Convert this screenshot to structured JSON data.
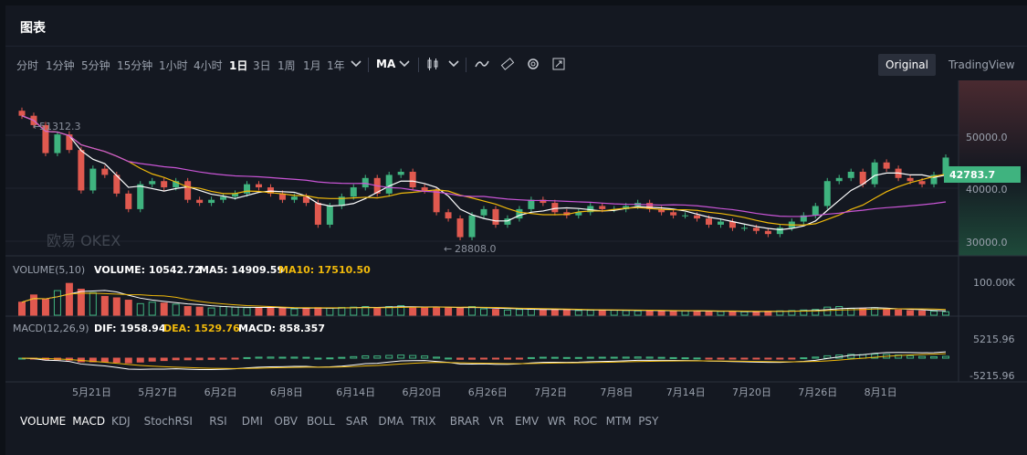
{
  "header": {
    "title": "图表"
  },
  "toolbar": {
    "intervals": [
      "分时",
      "1分钟",
      "5分钟",
      "15分钟",
      "1小时",
      "4小时",
      "1日",
      "3日",
      "1周",
      "1月",
      "1年"
    ],
    "active_interval": "1日",
    "ma_label": "MA",
    "modes": [
      "Original",
      "TradingView"
    ],
    "active_mode": "Original"
  },
  "price_chart": {
    "high_marker": "51312.3",
    "low_marker": "28808.0",
    "current_price": "42783.7",
    "y_ticks": [
      "50000.0",
      "40000.0",
      "30000.0"
    ],
    "watermark": "欧易 OKEX"
  },
  "volume": {
    "label": "VOLUME(5,10)",
    "volume_text": "VOLUME: 10542.72",
    "ma5_text": "MA5: 14909.59",
    "ma10_text": "MA10: 17510.50",
    "y_tick": "100.00K"
  },
  "macd": {
    "label": "MACD(12,26,9)",
    "dif_text": "DIF: 1958.94",
    "dea_text": "DEA: 1529.76",
    "macd_text": "MACD: 858.357",
    "y_ticks": [
      "5215.96",
      "-5215.96"
    ]
  },
  "x_ticks": [
    "5月21日",
    "5月27日",
    "6月2日",
    "6月8日",
    "6月14日",
    "6月20日",
    "6月26日",
    "7月2日",
    "7月8日",
    "7月14日",
    "7月20日",
    "7月26日",
    "8月1日"
  ],
  "indicators": [
    "VOLUME",
    "MACD",
    "KDJ",
    "StochRSI",
    "RSI",
    "DMI",
    "OBV",
    "BOLL",
    "SAR",
    "DMA",
    "TRIX",
    "BRAR",
    "VR",
    "EMV",
    "WR",
    "ROC",
    "MTM",
    "PSY"
  ],
  "active_indicators": [
    "VOLUME",
    "MACD"
  ],
  "colors": {
    "up": "#3fb37f",
    "down": "#e0594f",
    "ma_white": "#ffffff",
    "ma_yellow": "#f0b90b",
    "ma_purple": "#c955d6"
  },
  "chart_data": {
    "type": "candlestick",
    "series": [
      {
        "name": "price",
        "values": [
          49500,
          48000,
          43500,
          46500,
          44000,
          37500,
          41000,
          40000,
          37000,
          34500,
          38500,
          39000,
          38000,
          39000,
          36000,
          35500,
          36000,
          36500,
          37000,
          38500,
          38000,
          37000,
          36000,
          36500,
          35500,
          32000,
          35000,
          36500,
          38000,
          39500,
          37000,
          40000,
          40500,
          38000,
          37500,
          34000,
          33000,
          30000,
          33500,
          34500,
          32000,
          33000,
          34500,
          36000,
          35500,
          34000,
          33500,
          34000,
          35000,
          34500,
          34500,
          35000,
          35500,
          34500,
          34000,
          33500,
          33500,
          33000,
          32000,
          32500,
          31500,
          31500,
          31000,
          30500,
          31500,
          32500,
          33500,
          35000,
          39000,
          39500,
          40500,
          38500,
          42000,
          41000,
          39500,
          39000,
          38500,
          40000,
          42783.7
        ]
      },
      {
        "name": "volume",
        "values": [
          45,
          70,
          55,
          85,
          110,
          90,
          78,
          65,
          60,
          52,
          40,
          45,
          42,
          38,
          30,
          28,
          25,
          30,
          28,
          26,
          25,
          28,
          24,
          22,
          24,
          26,
          25,
          27,
          28,
          30,
          25,
          30,
          33,
          28,
          26,
          27,
          25,
          26,
          30,
          22,
          20,
          18,
          20,
          22,
          19,
          20,
          18,
          16,
          17,
          18,
          17,
          16,
          15,
          16,
          15,
          14,
          15,
          14,
          13,
          13,
          14,
          12,
          12,
          14,
          15,
          16,
          18,
          20,
          28,
          30,
          24,
          22,
          26,
          20,
          18,
          16,
          15,
          14,
          12
        ]
      }
    ],
    "ylim": [
      27000,
      54000
    ]
  }
}
